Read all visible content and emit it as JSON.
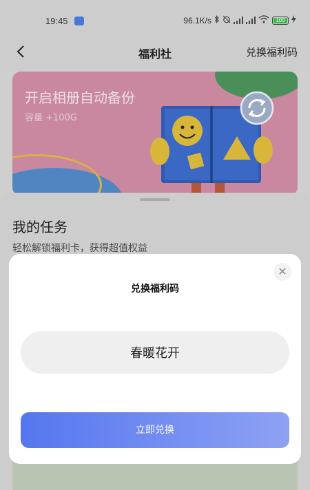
{
  "status_bar": {
    "time": "19:45",
    "network_speed": "96.1K/s",
    "battery": "100"
  },
  "nav": {
    "title": "福利社",
    "right_action": "兑换福利码"
  },
  "banner": {
    "title": "开启相册自动备份",
    "subtitle": "容量 +100G"
  },
  "tasks": {
    "title": "我的任务",
    "subtitle": "轻松解锁福利卡，获得超值权益"
  },
  "modal": {
    "title": "兑换福利码",
    "code_value": "春暖花开",
    "submit_label": "立即兑换"
  },
  "colors": {
    "accent_start": "#5576ef",
    "accent_end": "#8ea2f3",
    "banner_pink": "#c9889f",
    "battery_green": "#3cb84a"
  },
  "icons": {
    "back": "chevron-left-icon",
    "close": "close-icon",
    "sync": "sync-icon",
    "cloud": "cloud-icon"
  }
}
